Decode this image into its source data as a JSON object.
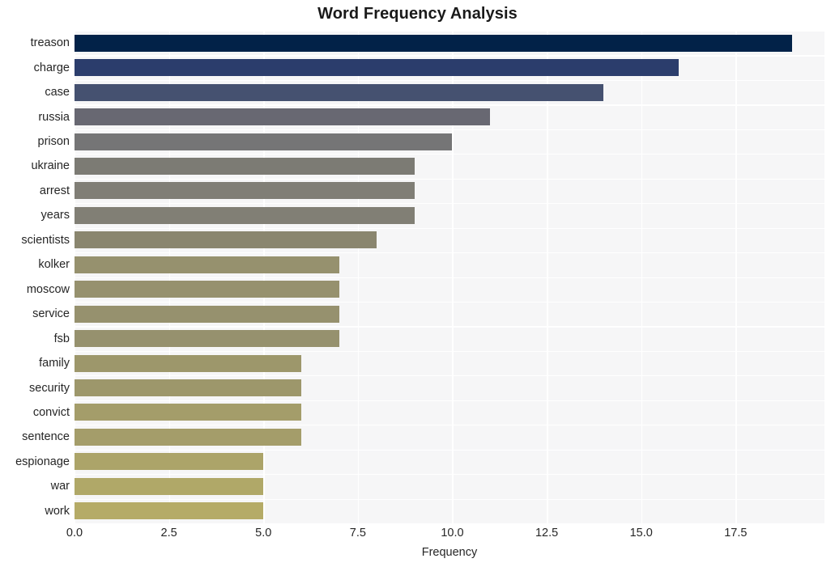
{
  "chart_data": {
    "type": "bar",
    "orientation": "horizontal",
    "title": "Word Frequency Analysis",
    "xlabel": "Frequency",
    "ylabel": "",
    "categories": [
      "treason",
      "charge",
      "case",
      "russia",
      "prison",
      "ukraine",
      "arrest",
      "years",
      "scientists",
      "kolker",
      "moscow",
      "service",
      "fsb",
      "family",
      "security",
      "convict",
      "sentence",
      "espionage",
      "war",
      "work"
    ],
    "values": [
      19,
      16,
      14,
      11,
      10,
      9,
      9,
      9,
      8,
      7,
      7,
      7,
      7,
      6,
      6,
      6,
      6,
      5,
      5,
      5
    ],
    "bar_colors": [
      "#022248",
      "#2b3d6c",
      "#455170",
      "#686872",
      "#757576",
      "#7c7b74",
      "#807e76",
      "#817f75",
      "#8a866f",
      "#96916e",
      "#96916e",
      "#96916e",
      "#96916e",
      "#9d976b",
      "#9d976b",
      "#a49d6a",
      "#a49d6a",
      "#aca469",
      "#b0a868",
      "#b5ab67"
    ],
    "xticks": [
      "0.0",
      "2.5",
      "5.0",
      "7.5",
      "10.0",
      "12.5",
      "15.0",
      "17.5"
    ],
    "xtick_values": [
      0,
      2.5,
      5,
      7.5,
      10,
      12.5,
      15,
      17.5
    ],
    "xlim": [
      0,
      19.85
    ],
    "grid": true,
    "legend": "none",
    "plot_background": "#f6f6f7",
    "gridline_color": "#ffffff",
    "figure_background": "#ffffff",
    "title_color": "#1a1a1a",
    "tick_color": "#262626"
  }
}
